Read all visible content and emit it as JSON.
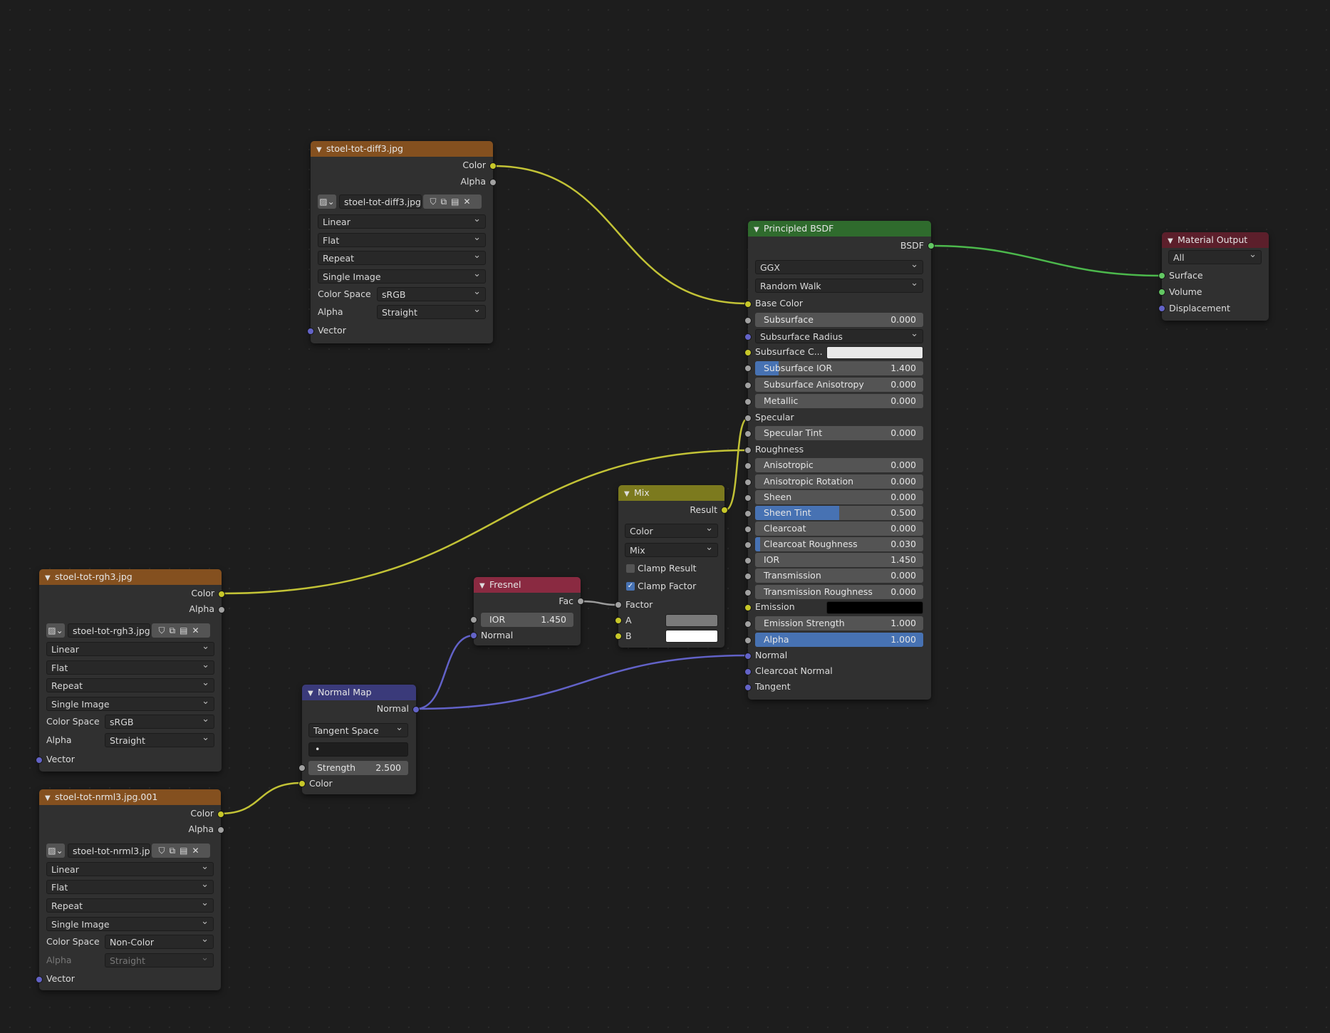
{
  "colors": {
    "image_header": "#84501f",
    "shader_header": "#2f6b2d",
    "output_header": "#5c1f2b",
    "vector_header": "#3a3a7a",
    "converter_header": "#7c7a1e",
    "fresnel_header": "#8a2a41",
    "socket_color": "#c7c729",
    "socket_float": "#a1a1a1",
    "socket_vector": "#6363c7",
    "socket_shader": "#63c763",
    "wire_color": "#c2c236",
    "wire_float": "#9c9c9c",
    "wire_vector": "#6262c8",
    "wire_shader": "#4cb84c",
    "slider_fill": "#4772b3"
  },
  "icons": {
    "collapse": "chevron-down-icon",
    "image_browse": "image-icon",
    "fake_user": "shield-icon",
    "duplicate": "duplicate-icon",
    "pack": "package-icon",
    "unlink": "close-icon"
  },
  "img_diff": {
    "title": "stoel-tot-diff3.jpg",
    "out_color": "Color",
    "out_alpha": "Alpha",
    "image_name": "stoel-tot-diff3.jpg",
    "interpolation": "Linear",
    "projection": "Flat",
    "extension": "Repeat",
    "source": "Single Image",
    "color_space_label": "Color Space",
    "color_space": "sRGB",
    "alpha_label": "Alpha",
    "alpha_mode": "Straight",
    "in_vector": "Vector"
  },
  "img_rgh": {
    "title": "stoel-tot-rgh3.jpg",
    "out_color": "Color",
    "out_alpha": "Alpha",
    "image_name": "stoel-tot-rgh3.jpg",
    "interpolation": "Linear",
    "projection": "Flat",
    "extension": "Repeat",
    "source": "Single Image",
    "color_space_label": "Color Space",
    "color_space": "sRGB",
    "alpha_label": "Alpha",
    "alpha_mode": "Straight",
    "in_vector": "Vector"
  },
  "img_nrm": {
    "title": "stoel-tot-nrml3.jpg.001",
    "out_color": "Color",
    "out_alpha": "Alpha",
    "image_name": "stoel-tot-nrml3.jp...",
    "interpolation": "Linear",
    "projection": "Flat",
    "extension": "Repeat",
    "source": "Single Image",
    "color_space_label": "Color Space",
    "color_space": "Non-Color",
    "alpha_label": "Alpha",
    "alpha_mode": "Straight",
    "in_vector": "Vector"
  },
  "normal_map": {
    "title": "Normal Map",
    "out_normal": "Normal",
    "space": "Tangent Space",
    "uv_map": "•",
    "strength_label": "Strength",
    "strength_value": "2.500",
    "in_color": "Color"
  },
  "fresnel": {
    "title": "Fresnel",
    "out_fac": "Fac",
    "ior_label": "IOR",
    "ior_value": "1.450",
    "in_normal": "Normal"
  },
  "mix": {
    "title": "Mix",
    "out_result": "Result",
    "data_type": "Color",
    "blend_mode": "Mix",
    "clamp_result": "Clamp Result",
    "clamp_result_checked": false,
    "clamp_factor": "Clamp Factor",
    "clamp_factor_checked": true,
    "in_factor": "Factor",
    "in_a": "A",
    "in_b": "B",
    "a_color": "#7a7a7a",
    "b_color": "#ffffff"
  },
  "bsdf": {
    "title": "Principled BSDF",
    "out_bsdf": "BSDF",
    "distribution": "GGX",
    "subsurface_method": "Random Walk",
    "base_color": "Base Color",
    "subsurface": {
      "label": "Subsurface",
      "value": "0.000",
      "fill": 0
    },
    "subsurface_radius": "Subsurface Radius",
    "subsurface_color": {
      "label": "Subsurface C...",
      "color": "#e8e8e8"
    },
    "subsurface_ior": {
      "label": "Subsurface IOR",
      "value": "1.400",
      "fill": 0.14
    },
    "subsurface_anisotropy": {
      "label": "Subsurface Anisotropy",
      "value": "0.000",
      "fill": 0
    },
    "metallic": {
      "label": "Metallic",
      "value": "0.000",
      "fill": 0
    },
    "specular": "Specular",
    "specular_tint": {
      "label": "Specular Tint",
      "value": "0.000",
      "fill": 0
    },
    "roughness": "Roughness",
    "anisotropic": {
      "label": "Anisotropic",
      "value": "0.000",
      "fill": 0
    },
    "anisotropic_rotation": {
      "label": "Anisotropic Rotation",
      "value": "0.000",
      "fill": 0
    },
    "sheen": {
      "label": "Sheen",
      "value": "0.000",
      "fill": 0
    },
    "sheen_tint": {
      "label": "Sheen Tint",
      "value": "0.500",
      "fill": 0.5
    },
    "clearcoat": {
      "label": "Clearcoat",
      "value": "0.000",
      "fill": 0
    },
    "clearcoat_roughness": {
      "label": "Clearcoat Roughness",
      "value": "0.030",
      "fill": 0.03
    },
    "ior": {
      "label": "IOR",
      "value": "1.450",
      "fill": 0
    },
    "transmission": {
      "label": "Transmission",
      "value": "0.000",
      "fill": 0
    },
    "transmission_roughness": {
      "label": "Transmission Roughness",
      "value": "0.000",
      "fill": 0
    },
    "emission": {
      "label": "Emission",
      "color": "#000000"
    },
    "emission_strength": {
      "label": "Emission Strength",
      "value": "1.000",
      "fill": 0
    },
    "alpha": {
      "label": "Alpha",
      "value": "1.000",
      "fill": 1
    },
    "normal": "Normal",
    "clearcoat_normal": "Clearcoat Normal",
    "tangent": "Tangent"
  },
  "output": {
    "title": "Material Output",
    "target": "All",
    "surface": "Surface",
    "volume": "Volume",
    "displacement": "Displacement"
  }
}
